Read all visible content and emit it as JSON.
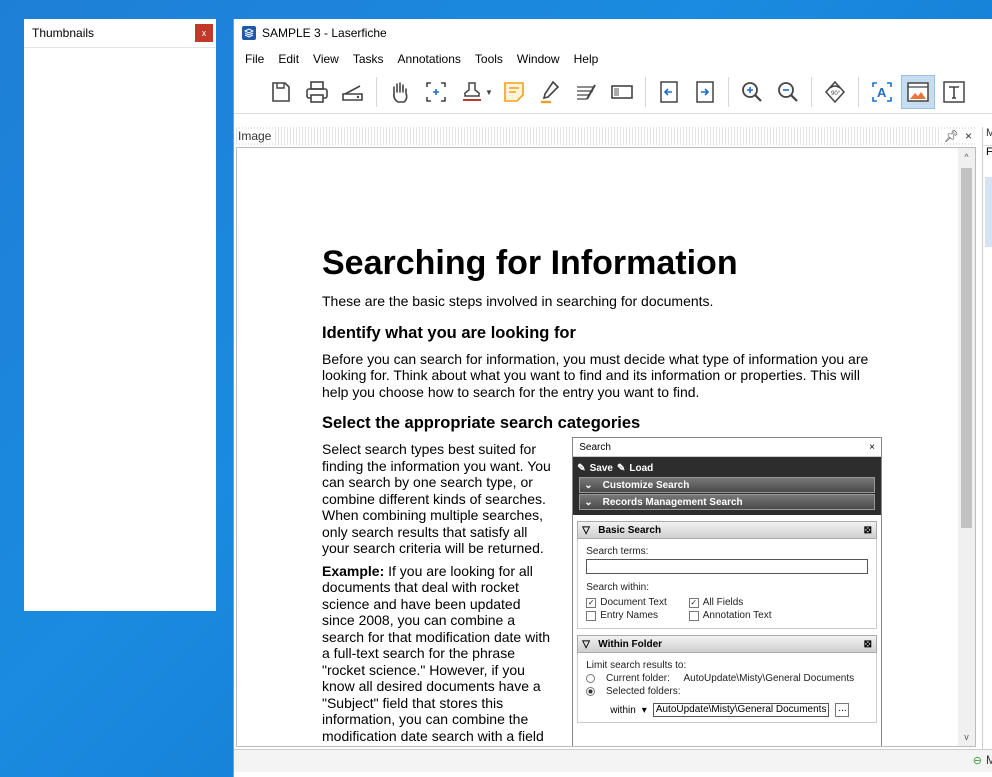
{
  "thumbnails": {
    "title": "Thumbnails",
    "close": "x"
  },
  "window": {
    "title": "SAMPLE 3 - Laserfiche"
  },
  "menu": [
    "File",
    "Edit",
    "View",
    "Tasks",
    "Annotations",
    "Tools",
    "Window",
    "Help"
  ],
  "toolbar": {
    "icons": [
      "save-icon",
      "print-icon",
      "scan-icon",
      "hand-tool-icon",
      "select-region-icon",
      "stamp-icon",
      "sticky-note-icon",
      "highlighter-icon",
      "strikethrough-icon",
      "redaction-icon",
      "previous-page-icon",
      "next-page-icon",
      "zoom-in-icon",
      "zoom-out-icon",
      "rotate-icon",
      "ocr-text-icon",
      "show-image-icon",
      "show-text-icon"
    ],
    "active": "show-image-icon"
  },
  "image_pane": {
    "label": "Image",
    "pin": "ᵖ",
    "close": "×"
  },
  "right_pane": {
    "label": "M",
    "row": "F"
  },
  "document": {
    "h1": "Searching for Information",
    "intro": "These are the basic steps involved in searching for documents.",
    "h2a": "Identify what you are looking for",
    "p1": "Before you can search for information, you must decide what type of information you are looking for. Think about what you want to find and its information or properties. This will help you choose how to search for the entry you want to find.",
    "h2b": "Select the appropriate search categories",
    "p2": "Select search types best suited for finding the information you want. You can search by one search type, or combine different kinds of searches. When combining multiple searches, only search results that satisfy all your search criteria will be returned.",
    "example_label": "Example:",
    "p3": " If you are looking for all documents that deal with rocket science and have been updated since 2008, you can combine a search for that modification date with a full-text search for the phrase \"rocket science.\" However, if you know all desired documents have a \"Subject\" field that stores this information, you can combine the modification date search with a field search instead."
  },
  "search_dialog": {
    "title": "Search",
    "close": "×",
    "save": "Save",
    "load": "Load",
    "customize": "Customize Search",
    "records": "Records Management Search",
    "basic": "Basic Search",
    "terms_label": "Search terms:",
    "within_label": "Search within:",
    "doc_text": "Document Text",
    "all_fields": "All Fields",
    "entry_names": "Entry Names",
    "annotation_text": "Annotation Text",
    "within_folder": "Within Folder",
    "limit_label": "Limit search results to:",
    "current_folder": "Current folder:",
    "current_folder_path": "AutoUpdate\\Misty\\General Documents",
    "selected_folders": "Selected folders:",
    "within_select": "within",
    "folder_path": "AutoUpdate\\Misty\\General Documents",
    "browse": "..."
  },
  "status": {
    "right": "M"
  }
}
